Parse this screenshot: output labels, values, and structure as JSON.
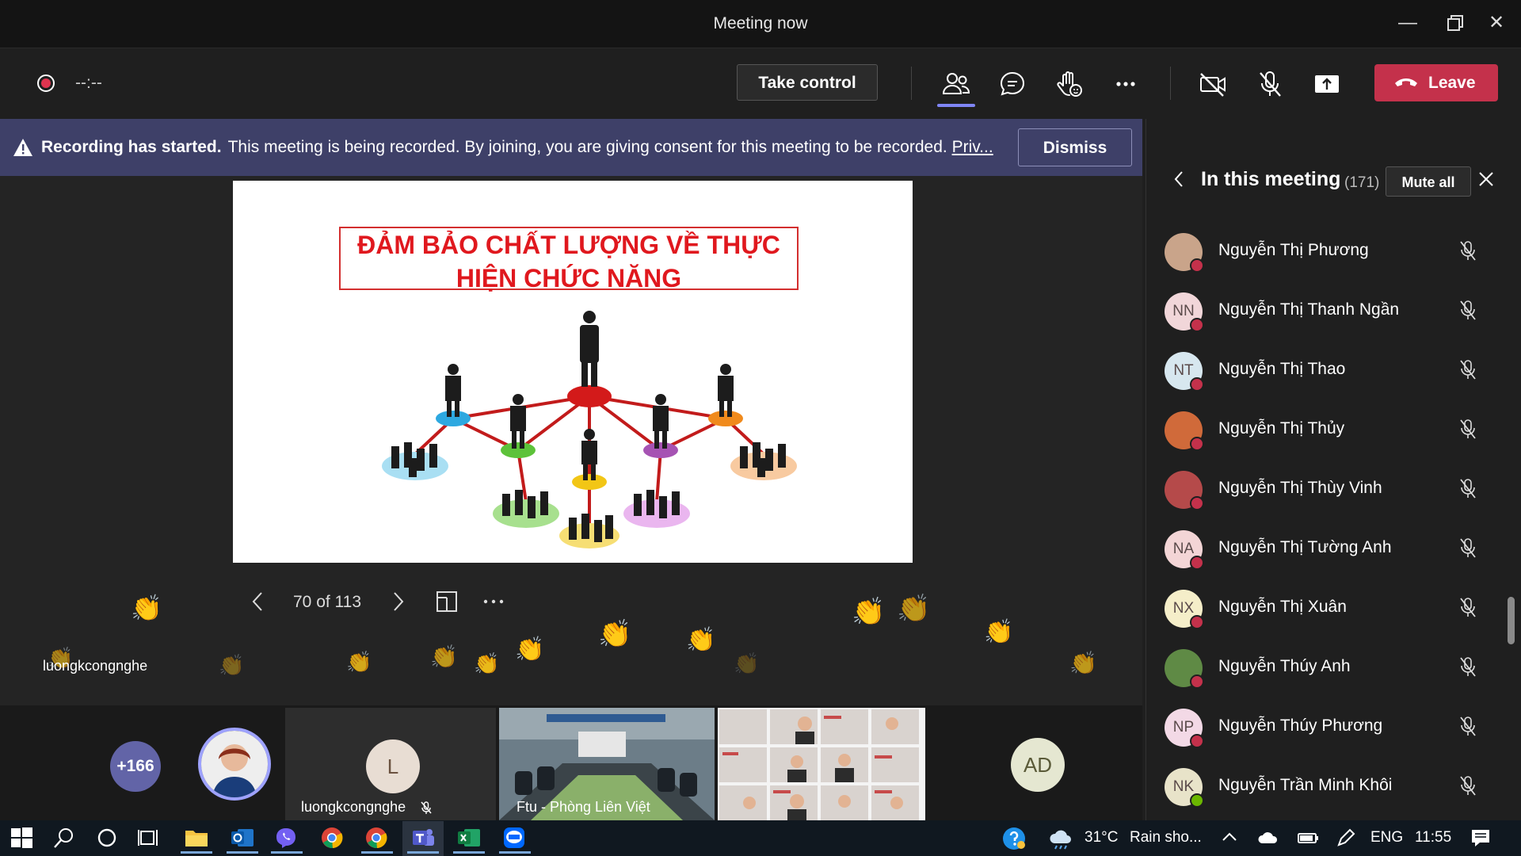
{
  "window": {
    "title": "Meeting now"
  },
  "toolbar": {
    "timer": "--:--",
    "take_control_label": "Take control",
    "leave_label": "Leave"
  },
  "banner": {
    "bold_text": "Recording has started.",
    "message": "This meeting is being recorded. By joining, you are giving consent for this meeting to be recorded.",
    "link_text": "Priv...",
    "dismiss_label": "Dismiss"
  },
  "slide": {
    "title": "ĐẢM BẢO CHẤT LƯỢNG VỀ THỰC\nHIỆN CHỨC NĂNG",
    "page_indicator": "70 of 113"
  },
  "presenter": {
    "name": "luongkcongnghe"
  },
  "strip": {
    "overflow_count": "+166",
    "tile_l_initial": "L",
    "tile_l_name": "luongkcongnghe",
    "tile_room_name": "Ftu - Phòng Liên Việt",
    "ad_initials": "AD"
  },
  "panel": {
    "title": "In this meeting",
    "count": "(171)",
    "mute_all_label": "Mute all",
    "participants": [
      {
        "name": "Nguyễn Thị Phương",
        "initials": "",
        "avatar_bg": "#c9a48a",
        "status": "busy"
      },
      {
        "name": "Nguyễn Thị Thanh Ngần",
        "initials": "NN",
        "avatar_bg": "#f1d6d9",
        "status": "busy"
      },
      {
        "name": "Nguyễn Thị Thao",
        "initials": "NT",
        "avatar_bg": "#d7e7ef",
        "status": "busy"
      },
      {
        "name": "Nguyễn Thị Thủy",
        "initials": "",
        "avatar_bg": "#d06a3a",
        "status": "busy"
      },
      {
        "name": "Nguyễn Thị Thùy Vinh",
        "initials": "",
        "avatar_bg": "#b54a4a",
        "status": "busy"
      },
      {
        "name": "Nguyễn Thị Tường Anh",
        "initials": "NA",
        "avatar_bg": "#f3d5d6",
        "status": "busy"
      },
      {
        "name": "Nguyễn Thị Xuân",
        "initials": "NX",
        "avatar_bg": "#f5eec9",
        "status": "busy"
      },
      {
        "name": "Nguyễn Thúy Anh",
        "initials": "",
        "avatar_bg": "#5f8a45",
        "status": "busy"
      },
      {
        "name": "Nguyễn Thúy Phương",
        "initials": "NP",
        "avatar_bg": "#f3d9e6",
        "status": "busy"
      },
      {
        "name": "Nguyễn Trần Minh Khôi",
        "initials": "NK",
        "avatar_bg": "#e8e3c9",
        "status": "available"
      }
    ]
  },
  "taskbar": {
    "temperature": "31°C",
    "weather": "Rain sho...",
    "language": "ENG",
    "time": "11:55"
  },
  "colors": {
    "accent": "#6264a7",
    "leave": "#c4314b",
    "banner": "#3e4068",
    "slide_title": "#e0181e"
  }
}
